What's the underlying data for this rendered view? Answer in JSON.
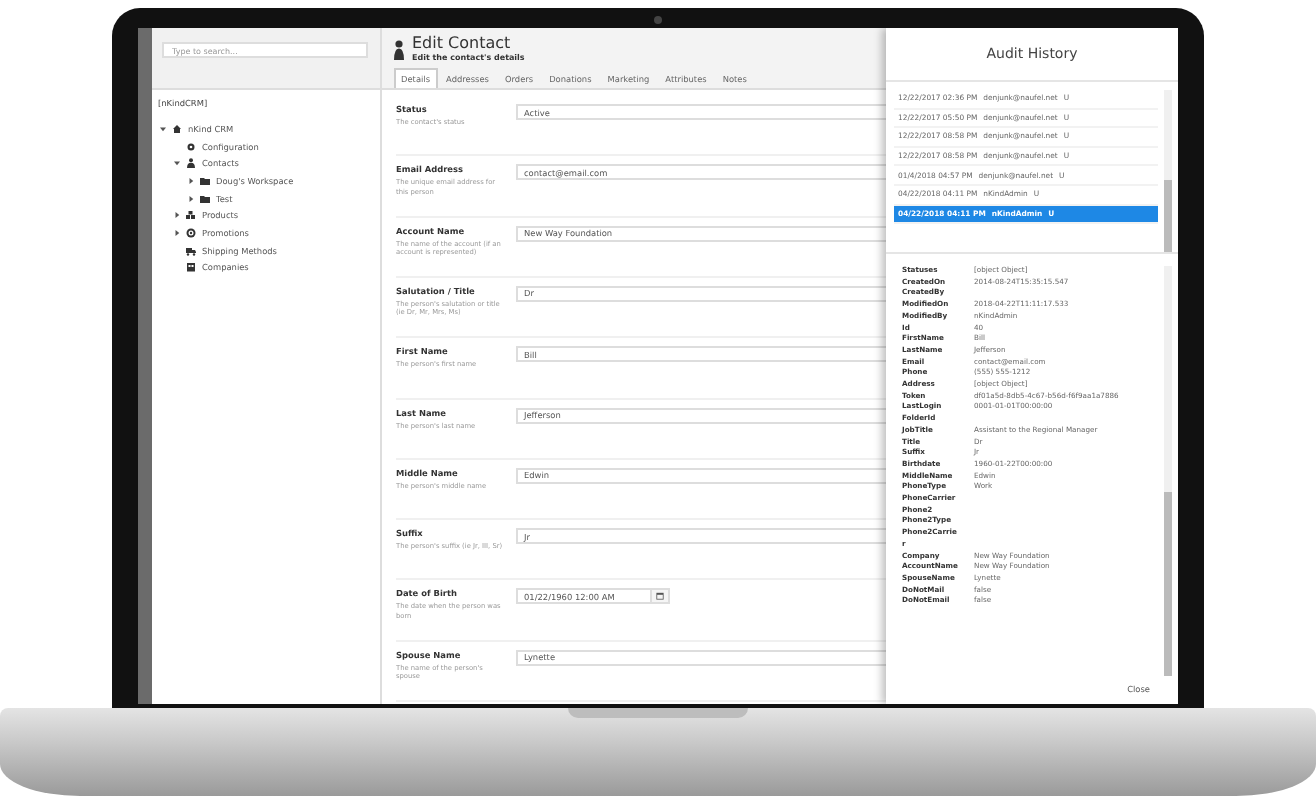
{
  "search": {
    "placeholder": "Type to search..."
  },
  "tree_title": "[nKindCRM]",
  "tree": [
    {
      "label": "nKind CRM",
      "kind": "site",
      "expanded": true,
      "children": [
        {
          "label": "Configuration",
          "kind": "gear"
        },
        {
          "label": "Contacts",
          "kind": "person",
          "expanded": true,
          "children": [
            {
              "label": "Doug's Workspace",
              "kind": "folder",
              "expanded": false
            },
            {
              "label": "Test",
              "kind": "folder",
              "expanded": false
            }
          ]
        },
        {
          "label": "Products",
          "kind": "boxes",
          "expanded": false
        },
        {
          "label": "Promotions",
          "kind": "target",
          "expanded": false
        },
        {
          "label": "Shipping Methods",
          "kind": "truck"
        },
        {
          "label": "Companies",
          "kind": "building"
        }
      ]
    }
  ],
  "header": {
    "title": "Edit Contact",
    "subtitle": "Edit the contact's details"
  },
  "tabs": [
    {
      "label": "Details",
      "selected": true
    },
    {
      "label": "Addresses",
      "selected": false
    },
    {
      "label": "Orders",
      "selected": false
    },
    {
      "label": "Donations",
      "selected": false
    },
    {
      "label": "Marketing",
      "selected": false
    },
    {
      "label": "Attributes",
      "selected": false
    },
    {
      "label": "Notes",
      "selected": false
    }
  ],
  "fields": [
    {
      "kind": "text",
      "label": "Status",
      "hint": "The contact's status",
      "value": "Active"
    },
    {
      "kind": "text",
      "label": "Email Address",
      "hint": "The unique email address for this person",
      "value": "contact@email.com"
    },
    {
      "kind": "text",
      "label": "Account Name",
      "hint": "The name of the account (if an account is represented)",
      "value": "New Way Foundation"
    },
    {
      "kind": "text",
      "label": "Salutation / Title",
      "hint": "The person's salutation or title (ie Dr, Mr, Mrs, Ms)",
      "value": "Dr"
    },
    {
      "kind": "text",
      "label": "First Name",
      "hint": "The person's first name",
      "value": "Bill"
    },
    {
      "kind": "text",
      "label": "Last Name",
      "hint": "The person's last name",
      "value": "Jefferson"
    },
    {
      "kind": "text",
      "label": "Middle Name",
      "hint": "The person's middle name",
      "value": "Edwin"
    },
    {
      "kind": "text",
      "label": "Suffix",
      "hint": "The person's suffix (ie Jr, III, Sr)",
      "value": "Jr"
    },
    {
      "kind": "date",
      "label": "Date of Birth",
      "hint": "The date when the person was born",
      "value": "01/22/1960 12:00 AM"
    },
    {
      "kind": "text",
      "label": "Spouse Name",
      "hint": "The name of the person's spouse",
      "value": "Lynette"
    }
  ],
  "audit": {
    "title": "Audit History",
    "entries": [
      {
        "time": "12/22/2017 02:36 PM",
        "user": "denjunk@naufel.net",
        "action": "U",
        "selected": false
      },
      {
        "time": "12/22/2017 05:50 PM",
        "user": "denjunk@naufel.net",
        "action": "U",
        "selected": false
      },
      {
        "time": "12/22/2017 08:58 PM",
        "user": "denjunk@naufel.net",
        "action": "U",
        "selected": false
      },
      {
        "time": "12/22/2017 08:58 PM",
        "user": "denjunk@naufel.net",
        "action": "U",
        "selected": false
      },
      {
        "time": "01/4/2018 04:57 PM",
        "user": "denjunk@naufel.net",
        "action": "U",
        "selected": false
      },
      {
        "time": "04/22/2018 04:11 PM",
        "user": "nKindAdmin",
        "action": "U",
        "selected": false
      },
      {
        "time": "04/22/2018 04:11 PM",
        "user": "nKindAdmin",
        "action": "U",
        "selected": true
      }
    ],
    "properties": [
      {
        "name": "Statuses",
        "value": "[object Object]"
      },
      {
        "name": "CreatedOn",
        "value": "2014-08-24T15:35:15.547"
      },
      {
        "name": "CreatedBy"
      },
      {
        "name": "ModifiedOn",
        "value": "2018-04-22T11:11:17.533"
      },
      {
        "name": "ModifiedBy",
        "value": "nKindAdmin"
      },
      {
        "name": "Id",
        "value": "40"
      },
      {
        "name": "FirstName",
        "value": "Bill"
      },
      {
        "name": "LastName",
        "value": "Jefferson"
      },
      {
        "name": "Email",
        "value": "contact@email.com"
      },
      {
        "name": "Phone",
        "value": "(555) 555-1212"
      },
      {
        "name": "Address",
        "value": "[object Object]"
      },
      {
        "name": "Token",
        "value": "df01a5d-8db5-4c67-b56d-f6f9aa1a7886"
      },
      {
        "name": "LastLogin",
        "value": "0001-01-01T00:00:00"
      },
      {
        "name": "FolderId"
      },
      {
        "name": "JobTitle",
        "value": "Assistant to the Regional Manager"
      },
      {
        "name": "Title",
        "value": "Dr"
      },
      {
        "name": "Suffix",
        "value": "Jr"
      },
      {
        "name": "Birthdate",
        "value": "1960-01-22T00:00:00"
      },
      {
        "name": "MiddleName",
        "value": "Edwin"
      },
      {
        "name": "PhoneType",
        "value": "Work"
      },
      {
        "name": "PhoneCarrier"
      },
      {
        "name": "Phone2"
      },
      {
        "name": "Phone2Type"
      },
      {
        "name": "Phone2Carrier"
      },
      {
        "name": "Company",
        "value": "New Way Foundation"
      },
      {
        "name": "AccountName",
        "value": "New Way Foundation"
      },
      {
        "name": "SpouseName",
        "value": "Lynette"
      },
      {
        "name": "DoNotMail",
        "value": "false"
      },
      {
        "name": "DoNotEmail",
        "value": "false"
      }
    ],
    "close": "Close"
  }
}
